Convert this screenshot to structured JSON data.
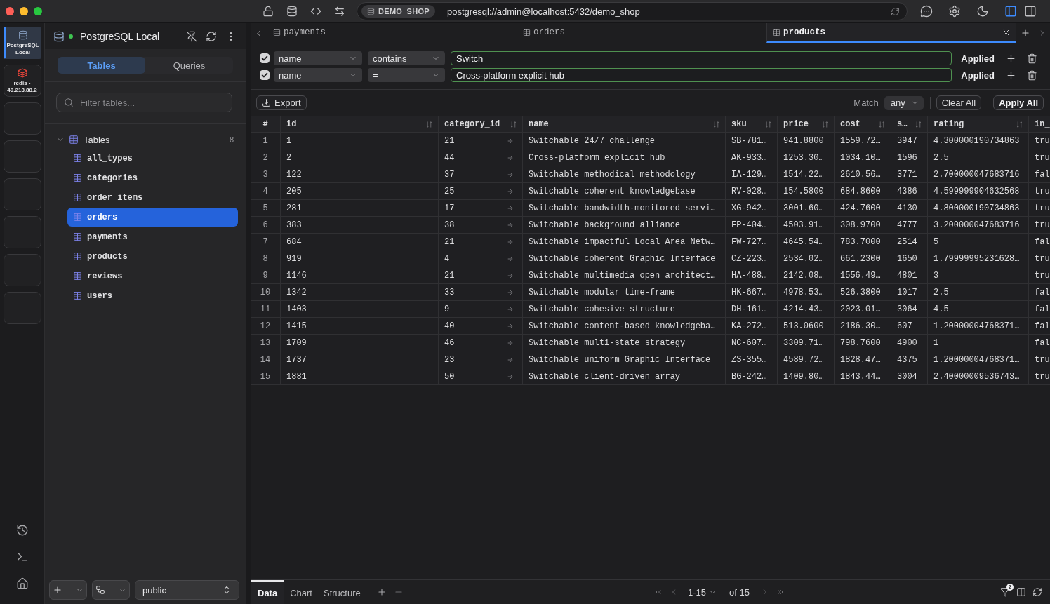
{
  "title_bar": {
    "connection_badge": "DEMO_SHOP",
    "url": "postgresql://admin@localhost:5432/demo_shop",
    "panel_toggles": [
      {
        "kind": "left",
        "selected": true
      },
      {
        "kind": "right",
        "selected": false
      }
    ]
  },
  "rail": {
    "connections": [
      {
        "kind": "postgres",
        "label": "PostgreSQL Local",
        "selected": true
      },
      {
        "kind": "redis",
        "label": "redis - 49.213.88.2",
        "selected": false
      },
      {
        "kind": "empty",
        "selected": false
      },
      {
        "kind": "empty",
        "selected": false
      },
      {
        "kind": "empty",
        "selected": false
      },
      {
        "kind": "empty",
        "selected": false
      },
      {
        "kind": "empty",
        "selected": false
      },
      {
        "kind": "empty",
        "selected": false
      }
    ]
  },
  "sidebar": {
    "connection_name": "PostgreSQL Local",
    "connected": true,
    "tabs": [
      {
        "label": "Tables",
        "selected": true
      },
      {
        "label": "Queries",
        "selected": false
      }
    ],
    "filter": {
      "placeholder": "Filter tables..."
    },
    "tree": {
      "label": "Tables",
      "count": "8",
      "expanded": true,
      "children": [
        {
          "label": "all_types",
          "selected": false
        },
        {
          "label": "categories",
          "selected": false
        },
        {
          "label": "order_items",
          "selected": false
        },
        {
          "label": "orders",
          "selected": true
        },
        {
          "label": "payments",
          "selected": false
        },
        {
          "label": "products",
          "selected": false
        },
        {
          "label": "reviews",
          "selected": false
        },
        {
          "label": "users",
          "selected": false
        }
      ]
    },
    "schema": "public"
  },
  "tabs": [
    {
      "label": "payments",
      "selected": false
    },
    {
      "label": "orders",
      "selected": false
    },
    {
      "label": "products",
      "selected": true
    }
  ],
  "filters": [
    {
      "enabled": true,
      "column": "name",
      "operator": "contains",
      "value": "Switch",
      "status": "Applied"
    },
    {
      "enabled": true,
      "column": "name",
      "operator": "=",
      "value": "Cross-platform explicit hub",
      "status": "Applied"
    }
  ],
  "table_toolbar": {
    "export": "Export",
    "match_label": "Match",
    "match": "any",
    "clear_all": "Clear All",
    "apply_all": "Apply All"
  },
  "table": {
    "columns": [
      {
        "label": "#",
        "kind": "index",
        "sortable": false
      },
      {
        "label": "id",
        "kind": "text",
        "sortable": true
      },
      {
        "label": "category_id",
        "kind": "foreign_key",
        "sortable": true
      },
      {
        "label": "name",
        "kind": "text",
        "sortable": true
      },
      {
        "label": "sku",
        "kind": "text",
        "sortable": true
      },
      {
        "label": "price",
        "kind": "text",
        "sortable": true
      },
      {
        "label": "cost",
        "kind": "text",
        "sortable": true
      },
      {
        "label": "s…",
        "kind": "text",
        "sortable": true
      },
      {
        "label": "rating",
        "kind": "text",
        "sortable": true
      },
      {
        "label": "in_",
        "kind": "text",
        "sortable": false
      }
    ],
    "rows": [
      [
        "1",
        "1",
        "21",
        "Switchable 24/7 challenge",
        "SB-781…",
        "941.8800",
        "1559.72…",
        "3947",
        "4.300000190734863",
        "tru"
      ],
      [
        "2",
        "2",
        "44",
        "Cross-platform explicit hub",
        "AK-933…",
        "1253.30…",
        "1034.10…",
        "1596",
        "2.5",
        "tru"
      ],
      [
        "3",
        "122",
        "37",
        "Switchable methodical methodology",
        "IA-129…",
        "1514.22…",
        "2610.56…",
        "3771",
        "2.700000047683716",
        "fal"
      ],
      [
        "4",
        "205",
        "25",
        "Switchable coherent knowledgebase",
        "RV-028…",
        "154.5800",
        "684.8600",
        "4386",
        "4.599999904632568",
        "tru"
      ],
      [
        "5",
        "281",
        "17",
        "Switchable bandwidth-monitored servi…",
        "XG-942…",
        "3001.60…",
        "424.7600",
        "4130",
        "4.800000190734863",
        "tru"
      ],
      [
        "6",
        "383",
        "38",
        "Switchable background alliance",
        "FP-404…",
        "4503.91…",
        "308.9700",
        "4777",
        "3.200000047683716",
        "tru"
      ],
      [
        "7",
        "684",
        "21",
        "Switchable impactful Local Area Netw…",
        "FW-727…",
        "4645.54…",
        "783.7000",
        "2514",
        "5",
        "fal"
      ],
      [
        "8",
        "919",
        "4",
        "Switchable coherent Graphic Interface",
        "CZ-223…",
        "2534.02…",
        "661.2300",
        "1650",
        "1.79999995231628…",
        "tru"
      ],
      [
        "9",
        "1146",
        "21",
        "Switchable multimedia open architect…",
        "HA-488…",
        "2142.08…",
        "1556.49…",
        "4801",
        "3",
        "tru"
      ],
      [
        "10",
        "1342",
        "33",
        "Switchable modular time-frame",
        "HK-667…",
        "4978.53…",
        "526.3800",
        "1017",
        "2.5",
        "fal"
      ],
      [
        "11",
        "1403",
        "9",
        "Switchable cohesive structure",
        "DH-161…",
        "4214.43…",
        "2023.01…",
        "3064",
        "4.5",
        "fal"
      ],
      [
        "12",
        "1415",
        "40",
        "Switchable content-based knowledgeba…",
        "KA-272…",
        "513.0600",
        "2186.30…",
        "607",
        "1.20000004768371…",
        "fal"
      ],
      [
        "13",
        "1709",
        "46",
        "Switchable multi-state strategy",
        "NC-607…",
        "3309.71…",
        "798.7600",
        "4900",
        "1",
        "fal"
      ],
      [
        "14",
        "1737",
        "23",
        "Switchable uniform Graphic Interface",
        "ZS-355…",
        "4589.72…",
        "1828.47…",
        "4375",
        "1.20000004768371…",
        "tru"
      ],
      [
        "15",
        "1881",
        "50",
        "Switchable client-driven array",
        "BG-242…",
        "1409.80…",
        "1843.44…",
        "3004",
        "2.40000009536743…",
        "tru"
      ]
    ]
  },
  "bottom_bar": {
    "views": [
      {
        "label": "Data",
        "selected": true
      },
      {
        "label": "Chart",
        "selected": false
      },
      {
        "label": "Structure",
        "selected": false
      }
    ],
    "range": "1-15",
    "total": "of 15",
    "active_filter_count": "2"
  }
}
